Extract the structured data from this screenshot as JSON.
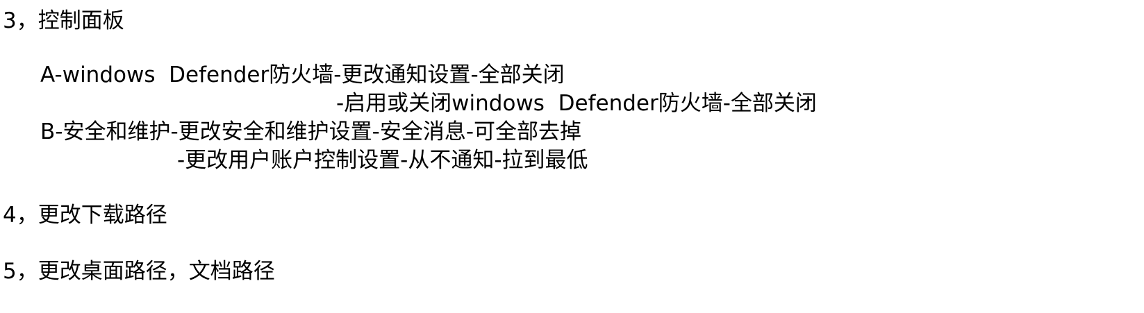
{
  "document": {
    "lines": [
      "3，控制面板",
      "A-windows  Defender防火墙-更改通知设置-全部关闭",
      "-启用或关闭windows  Defender防火墙-全部关闭",
      "B-安全和维护-更改安全和维护设置-安全消息-可全部去掉",
      "-更改用户账户控制设置-从不通知-拉到最低",
      "4，更改下载路径",
      "5，更改桌面路径，文档路径"
    ]
  }
}
